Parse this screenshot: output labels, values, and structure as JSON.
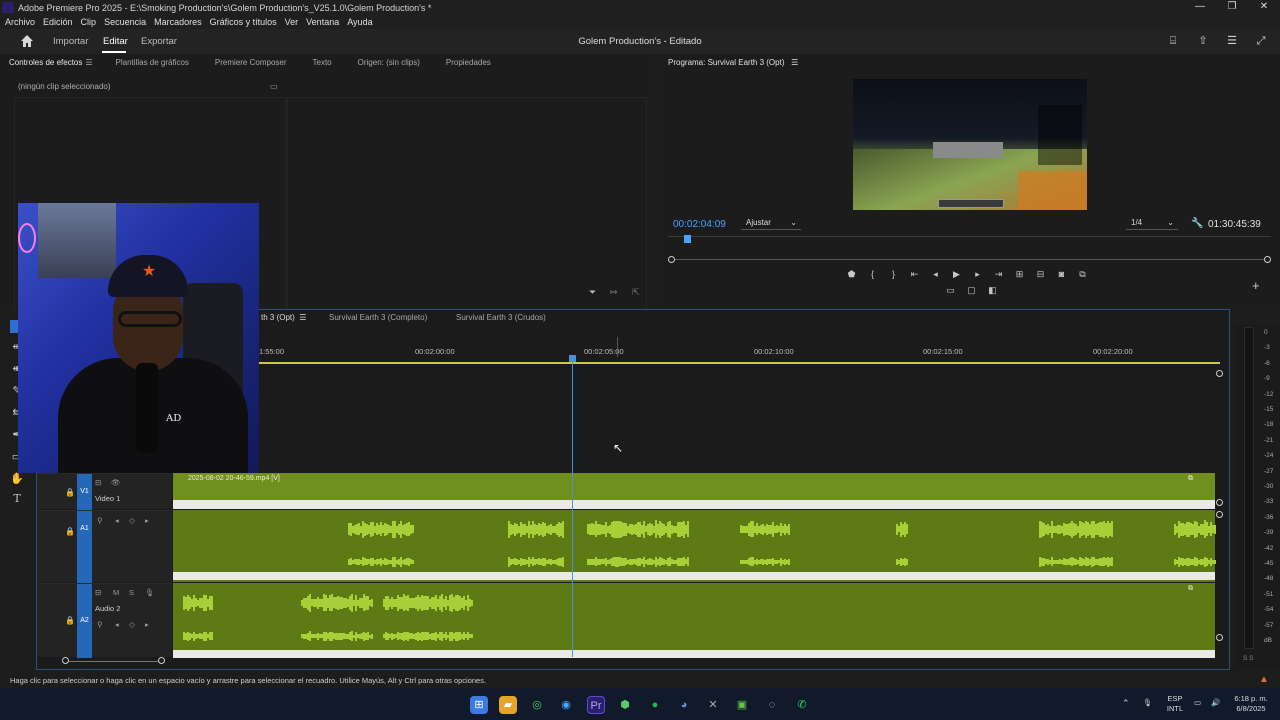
{
  "window": {
    "title": "Adobe Premiere Pro 2025 - E:\\Smoking Production's\\Golem Production's_V25.1.0\\Golem Production's *",
    "controls": [
      "—",
      "❐",
      "✕"
    ]
  },
  "menu": [
    "Archivo",
    "Edición",
    "Clip",
    "Secuencia",
    "Marcadores",
    "Gráficos y títulos",
    "Ver",
    "Ventana",
    "Ayuda"
  ],
  "header": {
    "nav": [
      "Importar",
      "Editar",
      "Exportar"
    ],
    "active": "Editar",
    "project_title": "Golem Production's - Editado"
  },
  "effects_panel": {
    "tabs": [
      "Controles de efectos",
      "Plantillas de gráficos",
      "Premiere Composer",
      "Texto",
      "Origen: (sin clips)",
      "Propiedades"
    ],
    "no_clip": "(ningún clip seleccionado)"
  },
  "program_monitor": {
    "tab": "Programa: Survival Earth 3 (Opt)",
    "timecode": "00:02:04:09",
    "fit": "Ajustar",
    "resolution": "1/4",
    "duration": "01:30:45:39",
    "playhead_fraction": 0.02
  },
  "timeline": {
    "tabs": [
      "th 3 (Opt)",
      "Survival Earth 3 (Completo)",
      "Survival Earth 3 (Crudos)"
    ],
    "ruler_labels": [
      "1:55:00",
      "00:02:00:00",
      "00:02:05:00",
      "00:02:10:00",
      "00:02:15:00",
      "00:02:20:00"
    ],
    "tracks": {
      "v1": {
        "target": "V1",
        "name": "Video 1",
        "clip": "2025-08-02 20-46-59.mp4 [V]"
      },
      "a1": {
        "target": "A1"
      },
      "a2": {
        "target": "A2",
        "name": "Audio 2",
        "m": "M",
        "s": "S"
      }
    }
  },
  "meters": {
    "scale": [
      "0",
      "-3",
      "-6",
      "-9",
      "-12",
      "-15",
      "-18",
      "-21",
      "-24",
      "-27",
      "-30",
      "-33",
      "-36",
      "-39",
      "-42",
      "-45",
      "-48",
      "-51",
      "-54",
      "-57",
      "dB"
    ],
    "footer": "S S"
  },
  "status": {
    "hint": "Haga clic para seleccionar o haga clic en un espacio vacío y arrastre para seleccionar el recuadro. Utilice Mayús, Alt y Ctrl para otras opciones."
  },
  "taskbar": {
    "lang": "ESP",
    "layout": "INTL",
    "time": "6:18 p. m.",
    "date": "6/8/2025"
  },
  "colors": {
    "accent": "#4aa3ff",
    "clip_video": "#6f8f1f",
    "clip_audio": "#5e7a14",
    "waveform": "#a8cf38",
    "track_target": "#2767b8"
  }
}
